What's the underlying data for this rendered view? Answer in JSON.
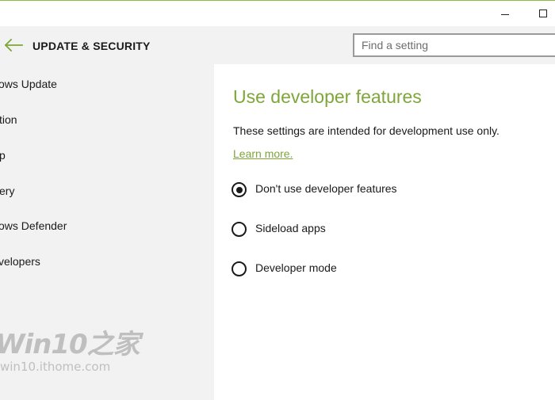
{
  "window": {
    "border_color": "#8cbf3f"
  },
  "header": {
    "title": "UPDATE & SECURITY",
    "search_placeholder": "Find a setting"
  },
  "sidebar": {
    "items": [
      {
        "label": "ows Update"
      },
      {
        "label": "tion"
      },
      {
        "label": "p"
      },
      {
        "label": "ery"
      },
      {
        "label": "ows Defender"
      },
      {
        "label": "velopers"
      }
    ]
  },
  "watermark": {
    "logo": "Win10之家",
    "url": "win10.ithome.com"
  },
  "main": {
    "title": "Use developer features",
    "description": "These settings are intended for development use only.",
    "learn_more": "Learn more.",
    "options": [
      {
        "label": "Don't use developer features",
        "selected": true
      },
      {
        "label": "Sideload apps",
        "selected": false
      },
      {
        "label": "Developer mode",
        "selected": false
      }
    ]
  },
  "colors": {
    "accent": "#7ea63a",
    "sidebar_bg": "#f2f2f2",
    "content_bg": "#ffffff"
  }
}
